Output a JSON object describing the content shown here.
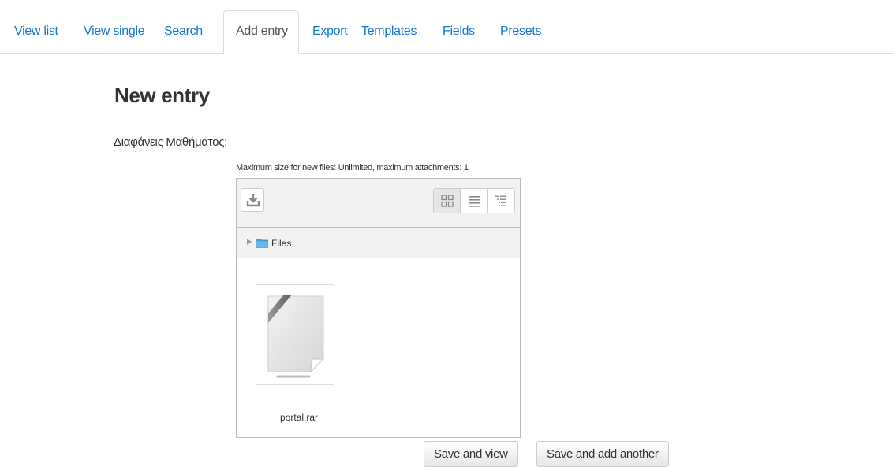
{
  "tabs": [
    {
      "label": "View list",
      "active": false
    },
    {
      "label": "View single",
      "active": false
    },
    {
      "label": "Search",
      "active": false
    },
    {
      "label": "Add entry",
      "active": true
    },
    {
      "label": "Export",
      "active": false
    },
    {
      "label": "Templates",
      "active": false
    },
    {
      "label": "Fields",
      "active": false
    },
    {
      "label": "Presets",
      "active": false
    }
  ],
  "page": {
    "title": "New entry"
  },
  "field": {
    "label": "Διαφάνεις Μαθήματος:",
    "limits_note": "Maximum size for new files: Unlimited, maximum attachments: 1"
  },
  "filemanager": {
    "toolbar": {
      "download_icon": "download-icon",
      "view_modes": [
        "icons-view-icon",
        "list-view-icon",
        "tree-view-icon"
      ],
      "active_view": "icons-view-icon"
    },
    "path": {
      "arrow_icon": "expand-arrow-icon",
      "folder_icon": "folder-icon",
      "label": "Files"
    },
    "files": [
      {
        "name": "portal.rar",
        "icon": "archive-file-icon"
      }
    ]
  },
  "buttons": {
    "save_view": "Save and view",
    "save_add": "Save and add another"
  },
  "colors": {
    "link": "#1177d1",
    "active_tab_text": "#555555",
    "border": "#bbbbbb",
    "toolbar_bg": "#f2f2f2"
  }
}
